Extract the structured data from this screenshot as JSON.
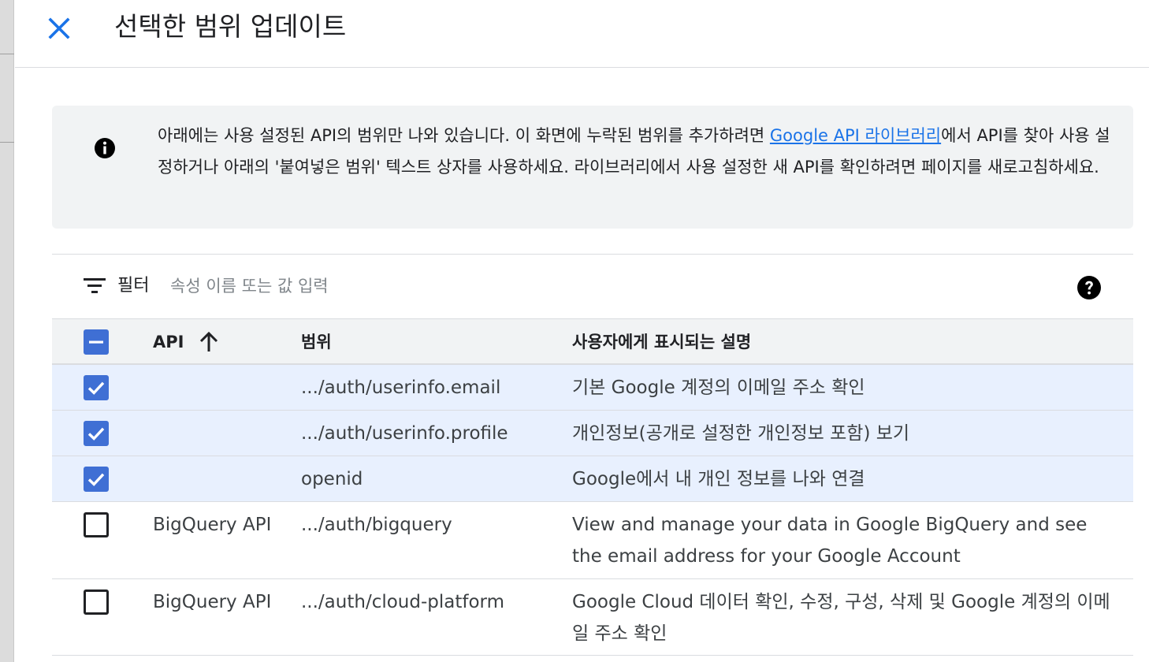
{
  "dialog": {
    "title": "선택한 범위 업데이트",
    "close_icon": "close-icon"
  },
  "info": {
    "icon": "info-icon",
    "text_before_link": "아래에는 사용 설정된 API의 범위만 나와 있습니다. 이 화면에 누락된 범위를 추가하려면 ",
    "link_text": "Google API 라이브러리",
    "text_after_link": "에서 API를 찾아 사용 설정하거나 아래의 '붙여넣은 범위' 텍스트 상자를 사용하세요. 라이브러리에서 사용 설정한 새 API를 확인하려면 페이지를 새로고침하세요."
  },
  "filter": {
    "icon": "filter-icon",
    "label": "필터",
    "placeholder": "속성 이름 또는 값 입력",
    "help_icon": "help-icon"
  },
  "table": {
    "header": {
      "select_all_state": "indeterminate",
      "api": "API",
      "sort_icon": "arrow-up-icon",
      "scope": "범위",
      "description": "사용자에게 표시되는 설명"
    },
    "rows": [
      {
        "checked": true,
        "api": "",
        "scope": ".../auth/userinfo.email",
        "description": "기본 Google 계정의 이메일 주소 확인"
      },
      {
        "checked": true,
        "api": "",
        "scope": ".../auth/userinfo.profile",
        "description": "개인정보(공개로 설정한 개인정보 포함) 보기"
      },
      {
        "checked": true,
        "api": "",
        "scope": "openid",
        "description": "Google에서 내 개인 정보를 나와 연결"
      },
      {
        "checked": false,
        "api": "BigQuery API",
        "scope": ".../auth/bigquery",
        "description": "View and manage your data in Google BigQuery and see the email address for your Google Account"
      },
      {
        "checked": false,
        "api": "BigQuery API",
        "scope": ".../auth/cloud-platform",
        "description": "Google Cloud 데이터 확인, 수정, 구성, 삭제 및 Google 계정의 이메일 주소 확인"
      }
    ]
  },
  "colors": {
    "accent": "#1a73e8",
    "checkbox_checked": "#3f6fd4",
    "selected_row": "#e8f0fe",
    "info_bg": "#f1f3f4"
  }
}
